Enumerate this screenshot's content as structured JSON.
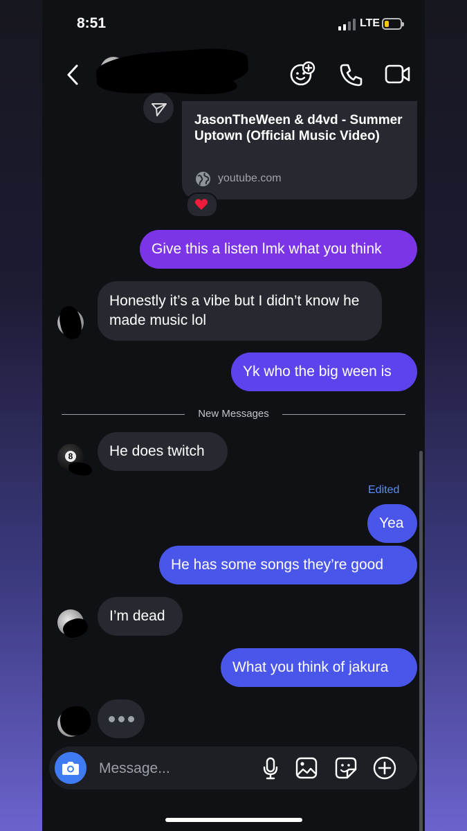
{
  "status_bar": {
    "time": "8:51",
    "network": "LTE",
    "battery_level": 0.25,
    "battery_color": "#f5c90a"
  },
  "header": {
    "back_icon": "chevron-left-icon",
    "actions": [
      "add-effect-icon",
      "phone-icon",
      "video-camera-icon"
    ]
  },
  "shared_link": {
    "title": "JasonTheWeen & d4vd - Summer Uptown (Official Music Video)",
    "url": "youtube.com",
    "reaction": "❤️"
  },
  "messages": {
    "m1": "Give this a listen lmk what you think",
    "m2": "Honestly it’s a vibe but I didn’t know he made music lol",
    "m3": "Yk who the big ween is",
    "new_messages_label": "New Messages",
    "m4": "He does twitch",
    "edited_label": "Edited",
    "m5": "Yea",
    "m6": "He has some songs they’re good",
    "m7": "I’m dead",
    "m8": "What you think of jakura"
  },
  "composer": {
    "placeholder": "Message...",
    "icons": [
      "camera-icon",
      "microphone-icon",
      "image-icon",
      "sticker-icon",
      "plus-icon"
    ]
  },
  "colors": {
    "sent_purple": "#7b35e6",
    "sent_violet": "#5b44ee",
    "sent_blue": "#4a55e9",
    "received": "#262930",
    "accent_blue": "#3f7cf3"
  }
}
